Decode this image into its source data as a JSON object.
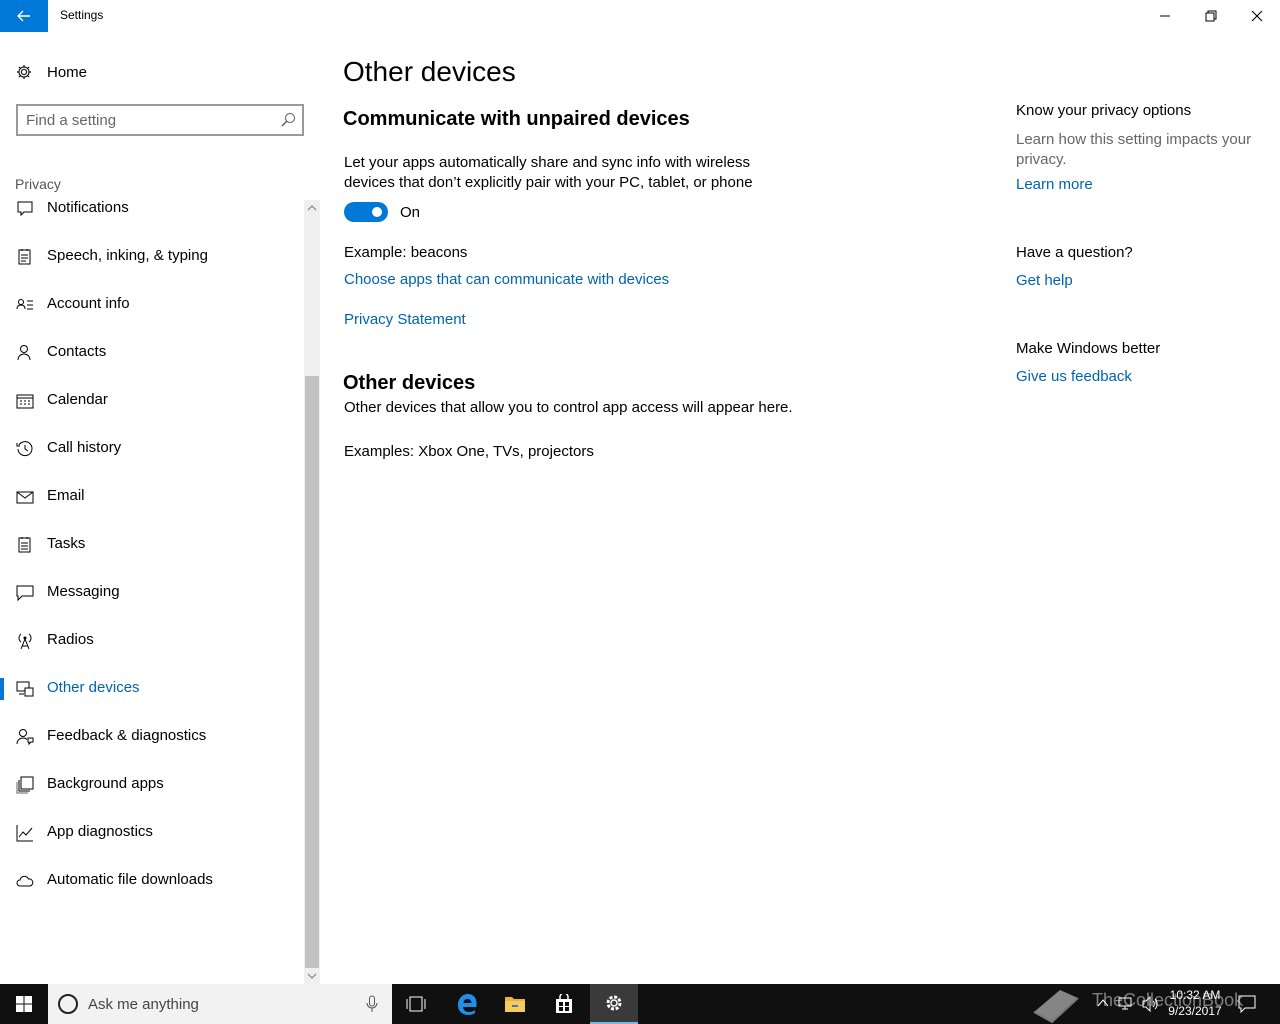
{
  "window": {
    "title": "Settings"
  },
  "sidebar": {
    "home_label": "Home",
    "search_placeholder": "Find a setting",
    "section_label": "Privacy",
    "items": [
      {
        "label": "Notifications",
        "icon": "notifications-icon"
      },
      {
        "label": "Speech, inking, & typing",
        "icon": "speech-icon"
      },
      {
        "label": "Account info",
        "icon": "account-info-icon"
      },
      {
        "label": "Contacts",
        "icon": "contacts-icon"
      },
      {
        "label": "Calendar",
        "icon": "calendar-icon"
      },
      {
        "label": "Call history",
        "icon": "call-history-icon"
      },
      {
        "label": "Email",
        "icon": "email-icon"
      },
      {
        "label": "Tasks",
        "icon": "tasks-icon"
      },
      {
        "label": "Messaging",
        "icon": "messaging-icon"
      },
      {
        "label": "Radios",
        "icon": "radios-icon"
      },
      {
        "label": "Other devices",
        "icon": "other-devices-icon",
        "selected": true
      },
      {
        "label": "Feedback & diagnostics",
        "icon": "feedback-icon"
      },
      {
        "label": "Background apps",
        "icon": "background-apps-icon"
      },
      {
        "label": "App diagnostics",
        "icon": "app-diagnostics-icon"
      },
      {
        "label": "Automatic file downloads",
        "icon": "cloud-icon"
      }
    ]
  },
  "main": {
    "page_title": "Other devices",
    "section1_title": "Communicate with unpaired devices",
    "section1_desc_line1": "Let your apps automatically share and sync info with wireless",
    "section1_desc_line2": "devices that don’t explicitly pair with your PC, tablet, or phone",
    "toggle_state": "On",
    "example_text": "Example: beacons",
    "choose_apps_link": "Choose apps that can communicate with devices",
    "privacy_statement_link": "Privacy Statement",
    "section2_title": "Other devices",
    "section2_desc": "Other devices that allow you to control app access will appear here.",
    "section2_examples": "Examples: Xbox One, TVs, projectors"
  },
  "right_panel": {
    "privacy_head": "Know your privacy options",
    "privacy_text_line1": "Learn how this setting impacts your",
    "privacy_text_line2": "privacy.",
    "learn_more": "Learn more",
    "question_head": "Have a question?",
    "get_help": "Get help",
    "better_head": "Make Windows better",
    "feedback_link": "Give us feedback"
  },
  "taskbar": {
    "cortana_placeholder": "Ask me anything",
    "time": "10:32 AM",
    "date": "9/23/2017",
    "watermark": "TheCollectionBook"
  },
  "colors": {
    "accent": "#0078d7",
    "link": "#0063b1",
    "taskbar": "#101010"
  }
}
